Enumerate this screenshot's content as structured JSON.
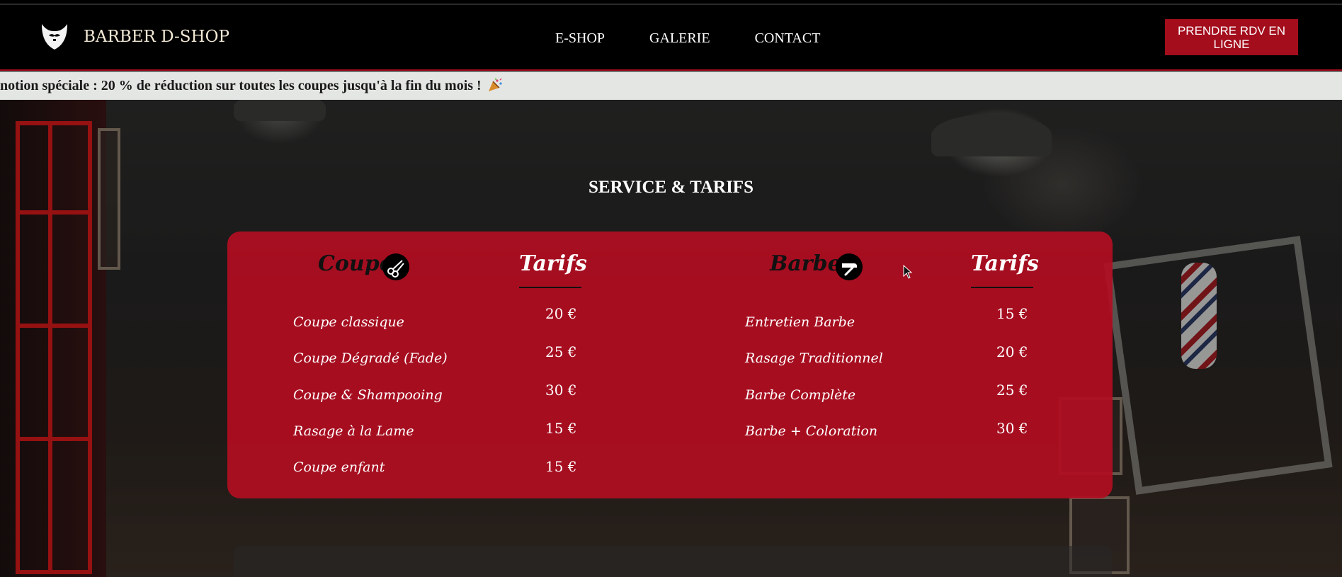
{
  "header": {
    "logo_text": "BARBER D-SHOP",
    "nav": [
      "E-SHOP",
      "GALERIE",
      "CONTACT"
    ],
    "cta_label": "PRENDRE RDV EN LIGNE"
  },
  "promo": {
    "text": "notion spéciale : 20 % de réduction sur toutes les coupes jusqu'à la fin du mois !"
  },
  "section": {
    "title": "SERVICE & TARIFS"
  },
  "coupe": {
    "heading": "Coupe",
    "icon": "scissors-icon",
    "price_heading": "Tarifs",
    "items": [
      {
        "name": "Coupe classique",
        "price": "20 €"
      },
      {
        "name": "Coupe Dégradé (Fade)",
        "price": "25 €"
      },
      {
        "name": "Coupe & Shampooing",
        "price": "30 €"
      },
      {
        "name": "Rasage à la Lame",
        "price": "15 €"
      },
      {
        "name": "Coupe enfant",
        "price": "15 €"
      }
    ]
  },
  "barbe": {
    "heading": "Barbe",
    "icon": "razor-icon",
    "price_heading": "Tarifs",
    "items": [
      {
        "name": "Entretien Barbe",
        "price": "15 €"
      },
      {
        "name": "Rasage Traditionnel",
        "price": "20 €"
      },
      {
        "name": "Barbe Complète",
        "price": "25 €"
      },
      {
        "name": "Barbe + Coloration",
        "price": "30 €"
      }
    ]
  },
  "colors": {
    "accent": "#a30d1c",
    "card": "#b00e21",
    "promo_bg": "#e4e6e3"
  }
}
